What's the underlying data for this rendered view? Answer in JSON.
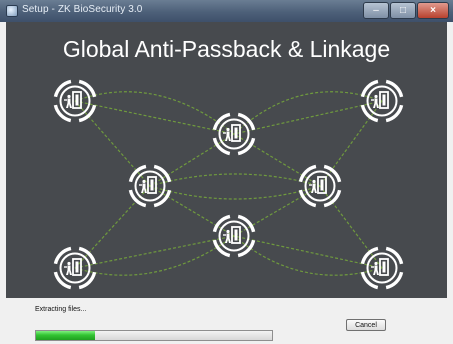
{
  "window": {
    "title": "Setup - ZK BioSecurity 3.0",
    "controls": [
      "minimize",
      "maximize",
      "close"
    ]
  },
  "banner": {
    "title": "Global Anti-Passback & Linkage",
    "node_icon": "door-exit-icon",
    "node_count": 8,
    "link_color": "#6f9a3e",
    "background": "#474a4e"
  },
  "status": {
    "text": "Extracting files..."
  },
  "progress": {
    "fraction": 0.25,
    "color": "#33c433"
  },
  "buttons": {
    "cancel": "Cancel"
  }
}
